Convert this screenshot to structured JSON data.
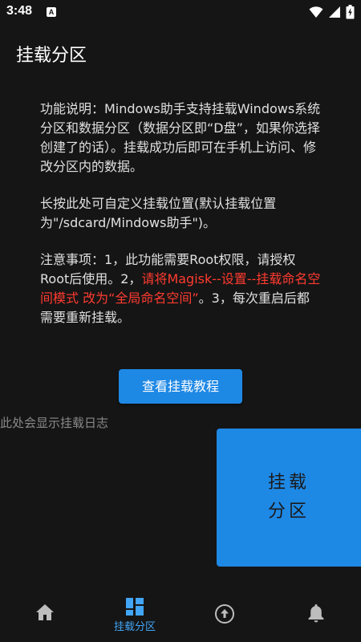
{
  "status_bar": {
    "time": "3:48",
    "notification_letter": "A",
    "icons": [
      "wifi-icon",
      "signal-icon",
      "battery-icon"
    ]
  },
  "app_bar": {
    "title": "挂载分区"
  },
  "description": {
    "feature_note": "功能说明：Mindows助手支持挂载Windows系统分区和数据分区（数据分区即“D盘”，如果你选择创建了的话）。挂载成功后即可在手机上访问、修改分区内的数据。",
    "long_press_note": "长按此处可自定义挂载位置(默认挂载位置为\"/sdcard/Mindows助手\")。",
    "notice_prefix": "注意事项：1，此功能需要Root权限，请授权Root后使用。2，",
    "notice_red": "请将Magisk--设置--挂载命名空间模式 改为“全局命名空间”",
    "notice_suffix": "。3，每次重启后都需要重新挂载。"
  },
  "tutorial_button": {
    "label": "查看挂载教程"
  },
  "log": {
    "placeholder": "此处会显示挂载日志"
  },
  "mount_button": {
    "label": "挂载分区"
  },
  "bottom_nav": {
    "items": [
      {
        "icon": "home-icon",
        "label": ""
      },
      {
        "icon": "grid-icon",
        "label": "挂载分区",
        "active": true
      },
      {
        "icon": "upload-circle-icon",
        "label": ""
      },
      {
        "icon": "bell-icon",
        "label": ""
      }
    ]
  },
  "colors": {
    "background": "#151515",
    "accent": "#1e88e5",
    "active_nav": "#42a5f5",
    "warning": "#ff3b30",
    "log_text": "#8a8a8a"
  }
}
